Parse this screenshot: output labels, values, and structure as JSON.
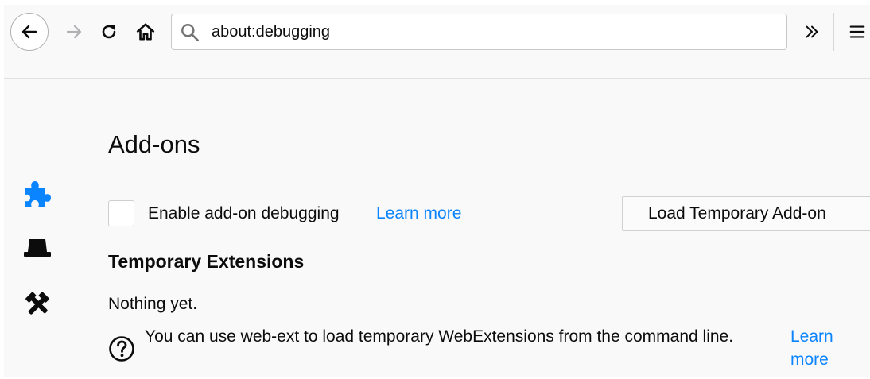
{
  "toolbar": {
    "back_icon": "back-arrow-icon",
    "forward_icon": "forward-arrow-icon",
    "reload_icon": "reload-icon",
    "home_icon": "home-icon",
    "url": "about:debugging",
    "overflow_icon": "chevron-double-right-icon",
    "menu_icon": "hamburger-menu-icon"
  },
  "sidebar": {
    "categories": [
      {
        "icon": "puzzle-piece-icon",
        "active": true,
        "color": "#0a84ff"
      },
      {
        "icon": "worker-hat-icon",
        "active": false,
        "color": "#0c0c0d"
      },
      {
        "icon": "tools-icon",
        "active": false,
        "color": "#0c0c0d"
      }
    ]
  },
  "main": {
    "title": "Add-ons",
    "enable_debugging_label": "Enable add-on debugging",
    "learn_more_label": "Learn more",
    "load_button_label": "Load Temporary Add-on",
    "section_title": "Temporary Extensions",
    "empty_text": "Nothing yet.",
    "tip_text": "You can use web-ext to load temporary WebExtensions from the command line.",
    "tip_learn_more": "Learn more"
  },
  "colors": {
    "accent": "#0a84ff",
    "background": "#f9f9fa",
    "text": "#0c0c0d"
  }
}
